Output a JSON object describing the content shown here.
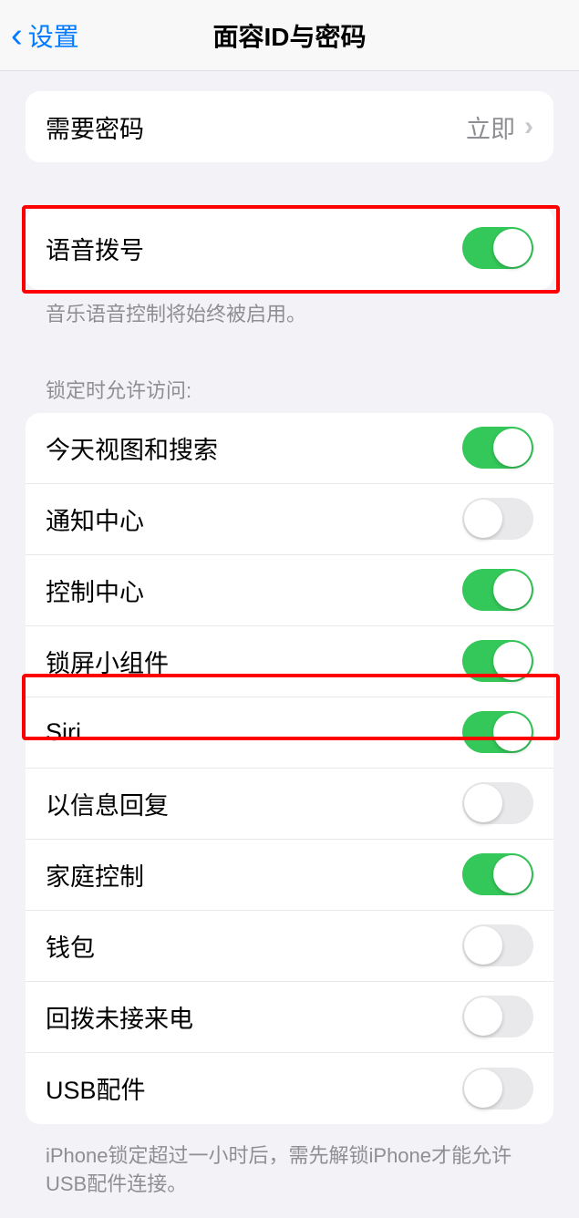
{
  "header": {
    "back_label": "设置",
    "title": "面容ID与密码"
  },
  "passcode_section": {
    "require_passcode_label": "需要密码",
    "require_passcode_value": "立即"
  },
  "voice_section": {
    "voice_dial_label": "语音拨号",
    "voice_dial_on": true,
    "footer": "音乐语音控制将始终被启用。"
  },
  "lock_access": {
    "header": "锁定时允许访问:",
    "items": [
      {
        "label": "今天视图和搜索",
        "on": true
      },
      {
        "label": "通知中心",
        "on": false
      },
      {
        "label": "控制中心",
        "on": true
      },
      {
        "label": "锁屏小组件",
        "on": true
      },
      {
        "label": "Siri",
        "on": true
      },
      {
        "label": "以信息回复",
        "on": false
      },
      {
        "label": "家庭控制",
        "on": true
      },
      {
        "label": "钱包",
        "on": false
      },
      {
        "label": "回拨未接来电",
        "on": false
      },
      {
        "label": "USB配件",
        "on": false
      }
    ],
    "footer": "iPhone锁定超过一小时后，需先解锁iPhone才能允许USB配件连接。"
  }
}
